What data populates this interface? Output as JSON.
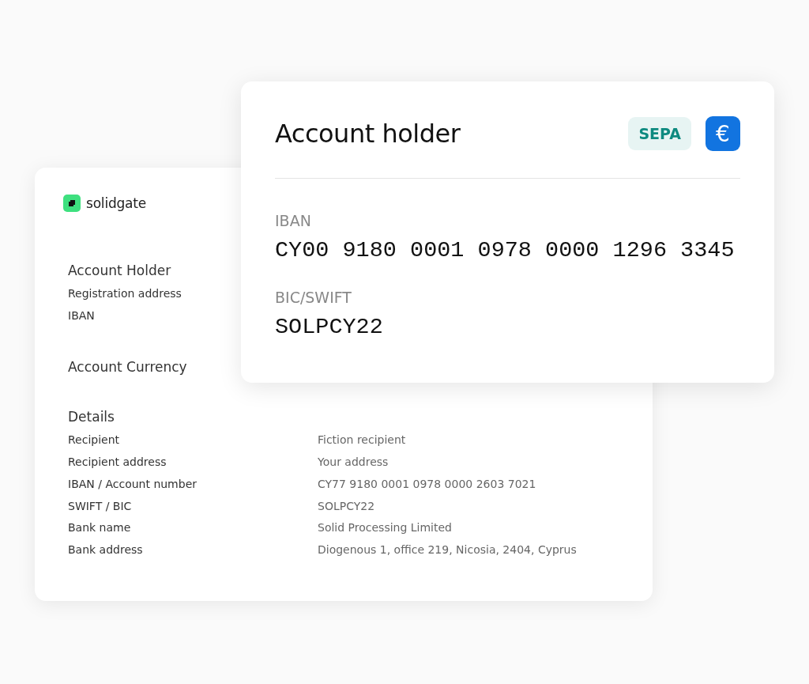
{
  "statement": {
    "brand": "solidgate",
    "sections": [
      {
        "title": "Account Holder",
        "rows": [
          {
            "label": "Registration address"
          },
          {
            "label": "IBAN"
          }
        ]
      },
      {
        "title": "Account Currency"
      },
      {
        "title": "Details",
        "rows": [
          {
            "label": "Recipient",
            "value": "Fiction recipient"
          },
          {
            "label": "Recipient address",
            "value": "Your address"
          },
          {
            "label": "IBAN / Account number",
            "value": "CY77 9180 0001 0978 0000 2603 7021"
          },
          {
            "label": "SWIFT / BIC",
            "value": "SOLPCY22"
          },
          {
            "label": "Bank name",
            "value": "Solid Processing Limited"
          },
          {
            "label": "Bank address",
            "value": "Diogenous 1, office 219, Nicosia, 2404, Cyprus"
          }
        ]
      }
    ]
  },
  "account_card": {
    "title": "Account holder",
    "badge": "SEPA",
    "currency_icon": "€",
    "fields": [
      {
        "label": "IBAN",
        "value": "CY00 9180 0001 0978 0000 1296 3345"
      },
      {
        "label": "BIC/SWIFT",
        "value": "SOLPCY22"
      }
    ]
  }
}
